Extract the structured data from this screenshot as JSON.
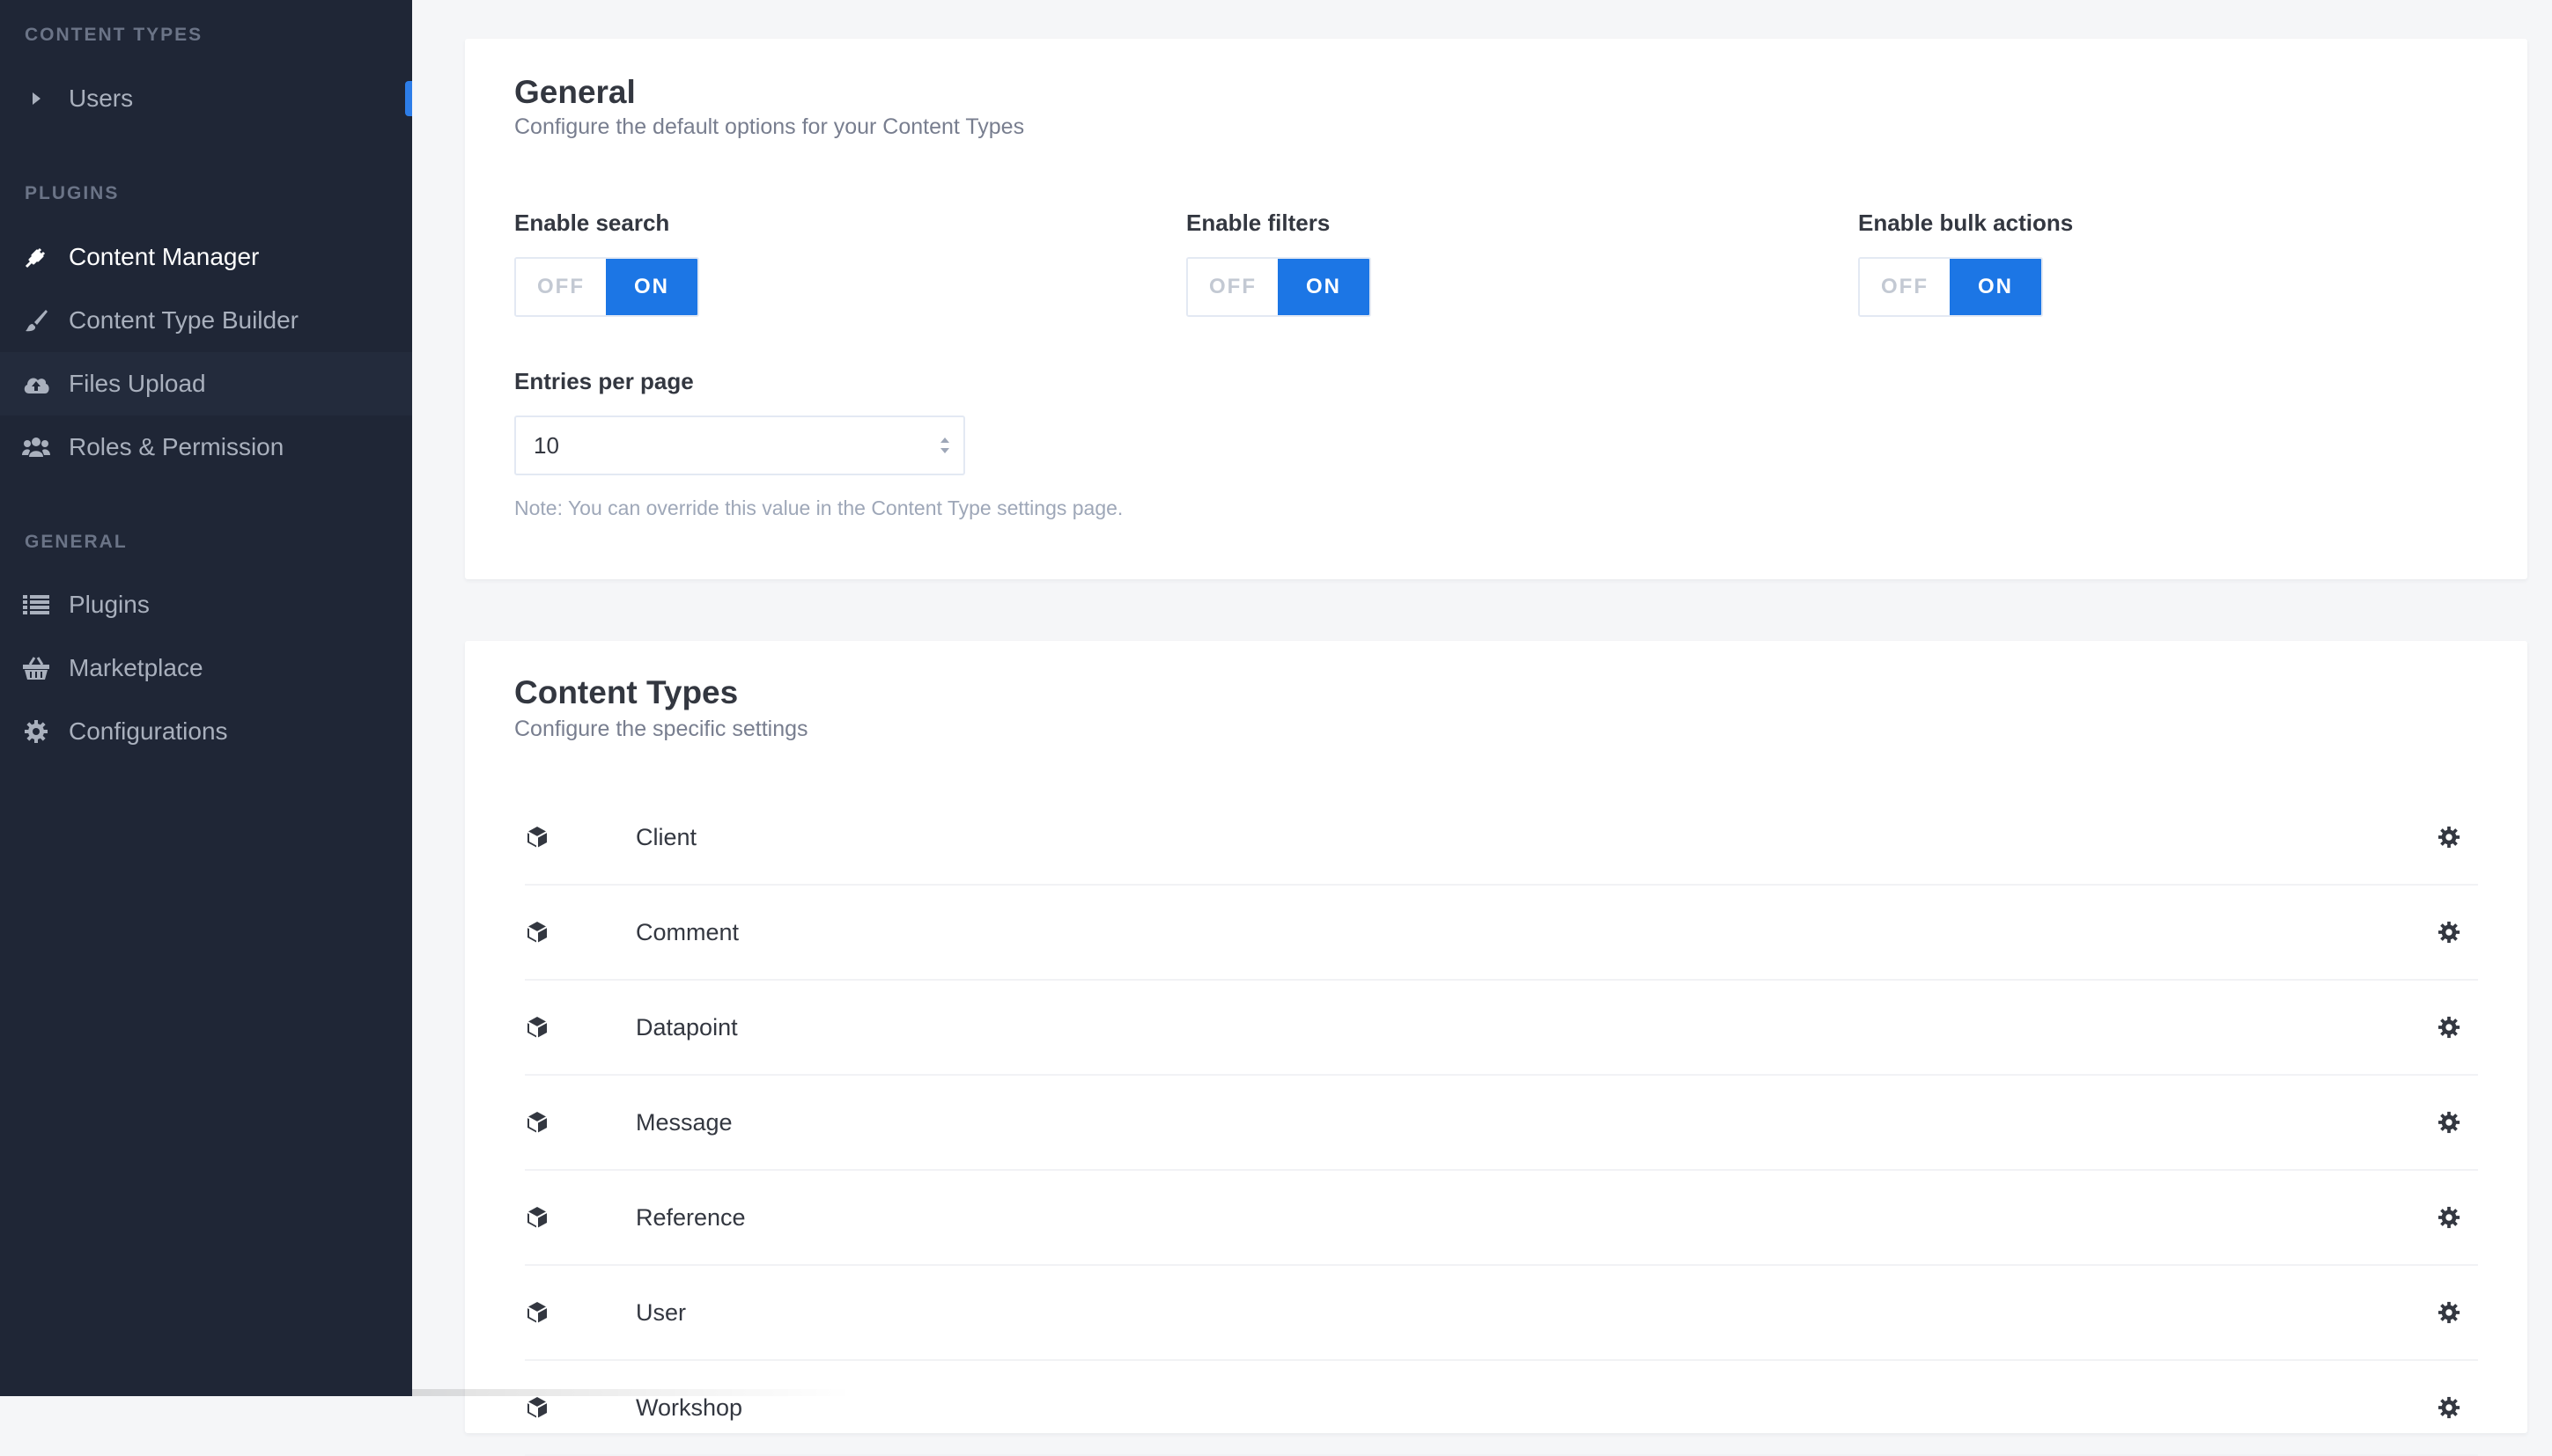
{
  "sidebar": {
    "sections": [
      {
        "heading": "CONTENT TYPES",
        "items": [
          {
            "label": "Users",
            "icon": "caret-right-icon"
          }
        ]
      },
      {
        "heading": "PLUGINS",
        "items": [
          {
            "label": "Content Manager",
            "icon": "plug-icon"
          },
          {
            "label": "Content Type Builder",
            "icon": "paintbrush-icon"
          },
          {
            "label": "Files Upload",
            "icon": "cloud-upload-icon"
          },
          {
            "label": "Roles & Permission",
            "icon": "users-icon"
          }
        ]
      },
      {
        "heading": "GENERAL",
        "items": [
          {
            "label": "Plugins",
            "icon": "list-icon"
          },
          {
            "label": "Marketplace",
            "icon": "basket-icon"
          },
          {
            "label": "Configurations",
            "icon": "gear-icon"
          }
        ]
      }
    ],
    "active_item": "Content Manager",
    "hovered_item": "Files Upload"
  },
  "general": {
    "title": "General",
    "subtitle": "Configure the default options for your Content Types",
    "toggles": [
      {
        "label": "Enable search",
        "off_label": "OFF",
        "on_label": "ON",
        "value": "ON"
      },
      {
        "label": "Enable filters",
        "off_label": "OFF",
        "on_label": "ON",
        "value": "ON"
      },
      {
        "label": "Enable bulk actions",
        "off_label": "OFF",
        "on_label": "ON",
        "value": "ON"
      }
    ],
    "entries_per_page": {
      "label": "Entries per page",
      "value": "10"
    },
    "note": "Note: You can override this value in the Content Type settings page."
  },
  "content_types": {
    "title": "Content Types",
    "subtitle": "Configure the specific settings",
    "items": [
      "Client",
      "Comment",
      "Datapoint",
      "Message",
      "Reference",
      "User",
      "Workshop"
    ]
  },
  "colors": {
    "sidebar_bg": "#1f2636",
    "accent": "#1c76e5",
    "page_bg": "#f5f6f8"
  }
}
